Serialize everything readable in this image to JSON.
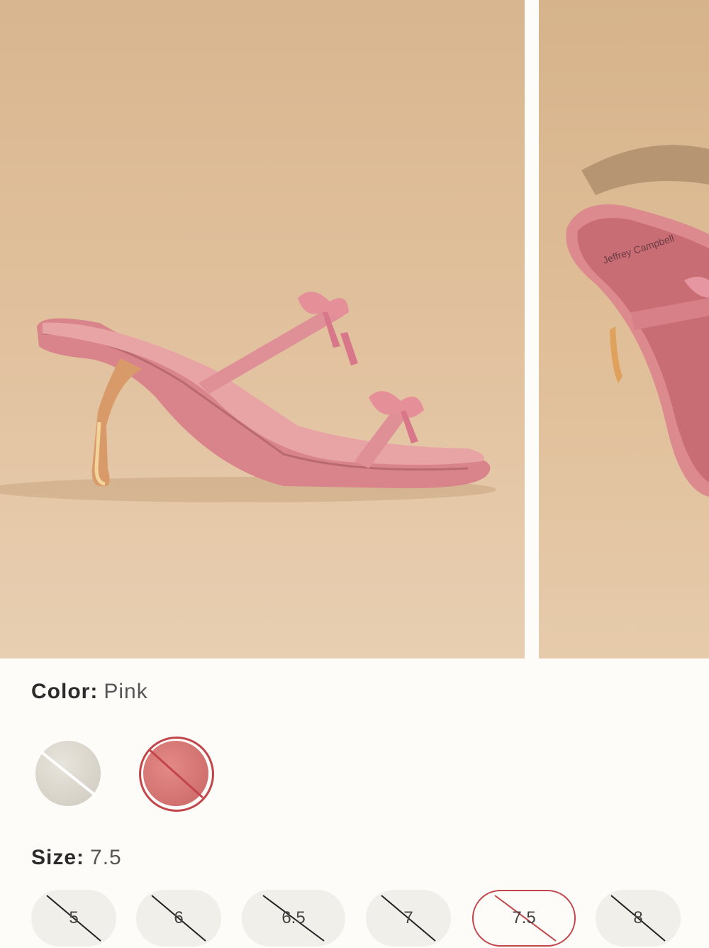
{
  "gallery": {
    "main_image_alt": "",
    "side_image_alt": "",
    "insole_brand_text": "Jeffrey Campbell"
  },
  "color": {
    "label": "Color:",
    "value": "Pink",
    "swatches": [
      {
        "name": "Cream",
        "hex": "#dcd8ce",
        "selected": false,
        "unavailable": true
      },
      {
        "name": "Pink",
        "hex": "#d47472",
        "selected": true,
        "unavailable": true
      }
    ]
  },
  "size": {
    "label": "Size:",
    "value": "7.5",
    "options": [
      {
        "label": "5",
        "unavailable": true,
        "selected": false
      },
      {
        "label": "6",
        "unavailable": true,
        "selected": false
      },
      {
        "label": "6.5",
        "unavailable": true,
        "selected": false
      },
      {
        "label": "7",
        "unavailable": true,
        "selected": false
      },
      {
        "label": "7.5",
        "unavailable": true,
        "selected": true
      },
      {
        "label": "8",
        "unavailable": true,
        "selected": false
      }
    ]
  },
  "colors": {
    "accent": "#c2454b",
    "pill_bg": "#f1efea",
    "page_bg": "#fdfcf8",
    "shoe_pink": "#d98a8a"
  }
}
